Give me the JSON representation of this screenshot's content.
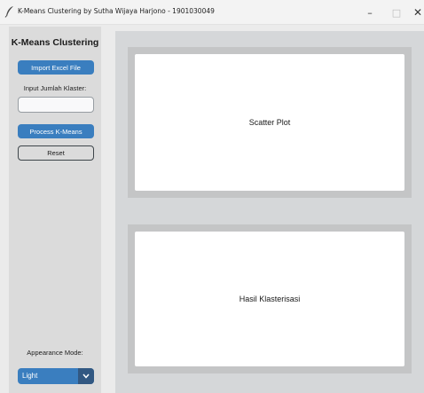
{
  "window": {
    "title": "K-Means Clustering by Sutha Wijaya Harjono - 1901030049",
    "minimize": "–",
    "maximize": "□",
    "close": "✕"
  },
  "sidebar": {
    "title": "K-Means Clustering",
    "import_button": "Import Excel File",
    "klaster_label": "Input Jumlah Klaster:",
    "klaster_value": "",
    "process_button": "Process K-Means",
    "reset_button": "Reset",
    "appearance_label": "Appearance Mode:",
    "appearance_value": "Light"
  },
  "main": {
    "scatter_label": "Scatter Plot",
    "hasil_label": "Hasil Klasterisasi"
  },
  "colors": {
    "accent": "#3a7ebf",
    "accent_dark": "#325882",
    "sidebar_bg": "#dbdbdb",
    "main_bg": "#d5d7d9",
    "panel_bg": "#c4c5c6"
  }
}
